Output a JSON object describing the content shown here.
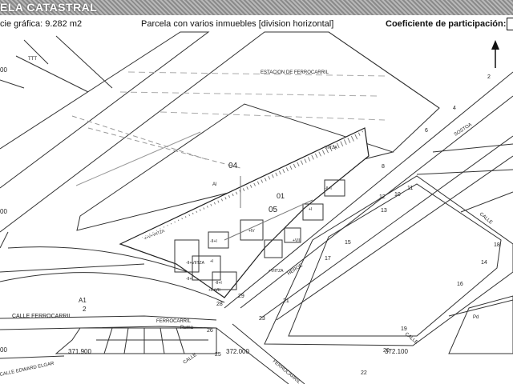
{
  "header": {
    "title": "ELA CATASTRAL",
    "surface_label": "cie gráfica: 9.282 m2",
    "parcel_type": "Parcela con varios inmuebles [division horizontal]",
    "coefficient_label": "Coeficiente de participación:"
  },
  "map": {
    "parcel_numbers": [
      "04",
      "05",
      "01"
    ],
    "station_label": "ESTACION DE FERROCARRIL",
    "streets": {
      "sostoa": "SOSTOA",
      "heroe": "HEROE",
      "calle_ferrocarril": "CALLE FERROCARRIL",
      "ferrocarril": "FERROCARRIL",
      "calle_edward_elgar": "CALLE EDWARD ELGAR",
      "calle_right_1": "CALLE",
      "calle_right_2": "CALLE",
      "calle_bottom": "CALLE",
      "ferrocarril_bottom": "FERROCARRIL",
      "ruma": "Ruma"
    },
    "coordinates": {
      "x_left": "371.900",
      "x_mid": "372.000",
      "x_right": "372.100",
      "y_top": "00",
      "y_mid": "00",
      "y_bottom": "00"
    },
    "misc_labels": {
      "a1": "A1",
      "two": "2",
      "al": "Al",
      "pd": "Pd",
      "ttt": "TTT"
    },
    "house_numbers": [
      "2",
      "4",
      "6",
      "8",
      "10",
      "12",
      "13",
      "11",
      "14",
      "15",
      "16",
      "17",
      "18",
      "19",
      "20",
      "21",
      "22",
      "23",
      "25",
      "26",
      "28",
      "29"
    ],
    "building_labels": [
      "-I+V+VIITZA",
      "VIITZA",
      "-II+I",
      "+IV",
      "-II+VIITZA",
      "-II+I",
      "+I",
      "+VII",
      "+VIITZA",
      "-II+I",
      "+II+VII",
      "-II+I",
      "+I"
    ]
  }
}
